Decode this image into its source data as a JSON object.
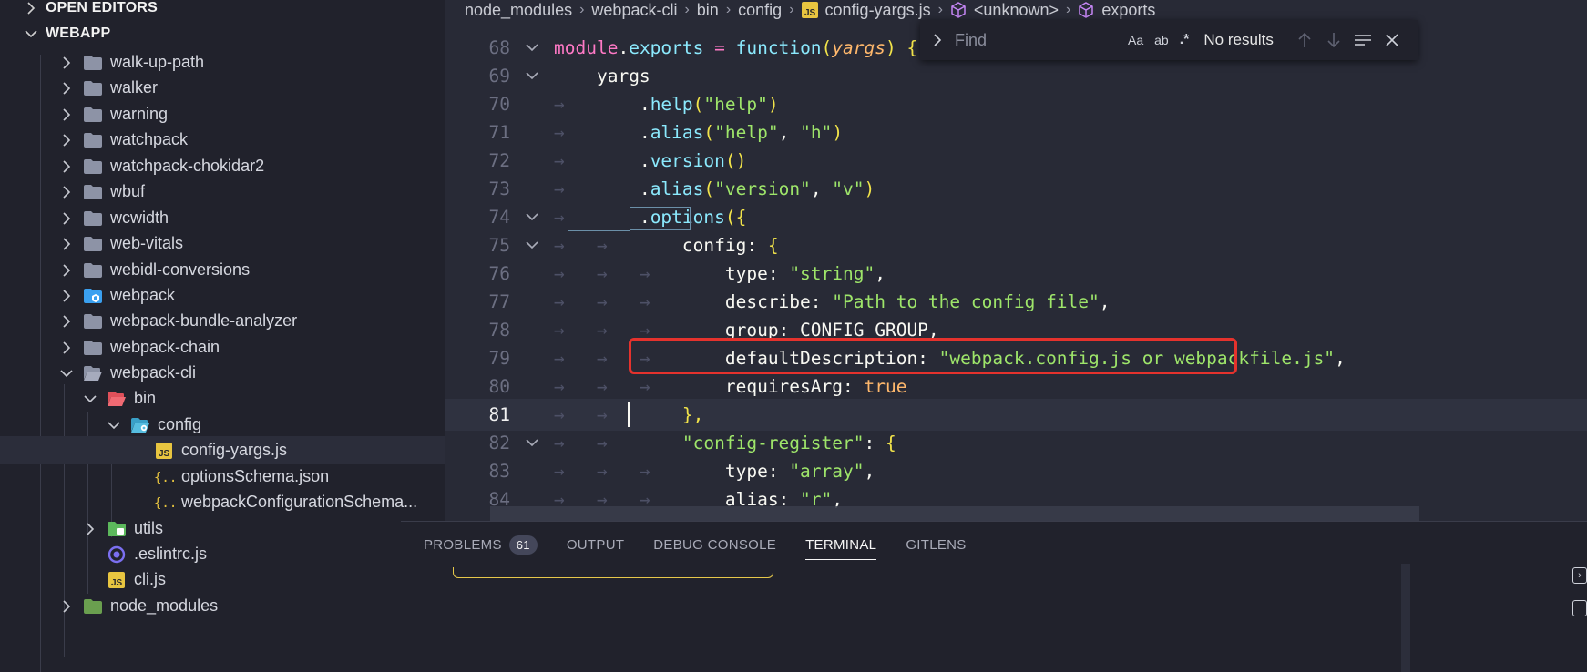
{
  "sidebar": {
    "open_editors_label": "OPEN EDITORS",
    "workspace_label": "WEBAPP",
    "items": [
      {
        "label": "walk-up-path",
        "kind": "folder",
        "icon": "folder-icon"
      },
      {
        "label": "walker",
        "kind": "folder",
        "icon": "folder-icon"
      },
      {
        "label": "warning",
        "kind": "folder",
        "icon": "folder-icon"
      },
      {
        "label": "watchpack",
        "kind": "folder",
        "icon": "folder-icon"
      },
      {
        "label": "watchpack-chokidar2",
        "kind": "folder",
        "icon": "folder-icon"
      },
      {
        "label": "wbuf",
        "kind": "folder",
        "icon": "folder-icon"
      },
      {
        "label": "wcwidth",
        "kind": "folder",
        "icon": "folder-icon"
      },
      {
        "label": "web-vitals",
        "kind": "folder",
        "icon": "folder-icon"
      },
      {
        "label": "webidl-conversions",
        "kind": "folder",
        "icon": "folder-icon"
      },
      {
        "label": "webpack",
        "kind": "folder",
        "icon": "webpack-folder-icon"
      },
      {
        "label": "webpack-bundle-analyzer",
        "kind": "folder",
        "icon": "folder-icon"
      },
      {
        "label": "webpack-chain",
        "kind": "folder",
        "icon": "folder-icon"
      },
      {
        "label": "webpack-cli",
        "kind": "folder-open",
        "icon": "folder-open-icon"
      },
      {
        "label": "bin",
        "kind": "folder-open",
        "icon": "bin-folder-icon"
      },
      {
        "label": "config",
        "kind": "folder-open",
        "icon": "config-folder-icon"
      },
      {
        "label": "config-yargs.js",
        "kind": "file",
        "icon": "js-file-icon"
      },
      {
        "label": "optionsSchema.json",
        "kind": "file",
        "icon": "json-file-icon"
      },
      {
        "label": "webpackConfigurationSchema...",
        "kind": "file",
        "icon": "json-file-icon"
      },
      {
        "label": "utils",
        "kind": "folder",
        "icon": "utils-folder-icon"
      },
      {
        "label": ".eslintrc.js",
        "kind": "file",
        "icon": "eslint-file-icon"
      },
      {
        "label": "cli.js",
        "kind": "file",
        "icon": "js-file-icon"
      },
      {
        "label": "node_modules",
        "kind": "folder",
        "icon": "node-modules-folder-icon"
      }
    ]
  },
  "breadcrumb": {
    "parts": [
      "node_modules",
      "webpack-cli",
      "bin",
      "config",
      "config-yargs.js",
      "<unknown>",
      "exports"
    ]
  },
  "find": {
    "placeholder": "Find",
    "match_case": "Aa",
    "whole_word": "ab",
    "regex": ".*",
    "result": "No results"
  },
  "editor": {
    "line_numbers": [
      "68",
      "69",
      "70",
      "71",
      "72",
      "73",
      "74",
      "75",
      "76",
      "77",
      "78",
      "79",
      "80",
      "81",
      "82",
      "83",
      "84"
    ],
    "current_line": "81",
    "lines": {
      "l68": {
        "a": "module",
        "b": ".",
        "c": "exports",
        "d": " = ",
        "e": "function",
        "f": "(",
        "g": "yargs",
        "h": ")",
        "i": " {"
      },
      "l69": {
        "a": "yargs"
      },
      "l70": {
        "a": ".",
        "b": "help",
        "c": "(",
        "d": "\"help\"",
        "e": ")"
      },
      "l71": {
        "a": ".",
        "b": "alias",
        "c": "(",
        "d": "\"help\"",
        "e": ", ",
        "f": "\"h\"",
        "g": ")"
      },
      "l72": {
        "a": ".",
        "b": "version",
        "c": "()"
      },
      "l73": {
        "a": ".",
        "b": "alias",
        "c": "(",
        "d": "\"version\"",
        "e": ", ",
        "f": "\"v\"",
        "g": ")"
      },
      "l74": {
        "a": ".",
        "b": "options",
        "c": "(",
        "d": "{"
      },
      "l75": {
        "a": "config: ",
        "b": "{"
      },
      "l76": {
        "a": "type: ",
        "b": "\"string\"",
        "c": ","
      },
      "l77": {
        "a": "describe: ",
        "b": "\"Path to the config file\"",
        "c": ","
      },
      "l78": {
        "a": "group: CONFIG_GROUP,"
      },
      "l79": {
        "a": "defaultDescription: ",
        "b": "\"webpack.config.js or webpackfile.js\"",
        "c": ","
      },
      "l80": {
        "a": "requiresArg: ",
        "b": "true"
      },
      "l81": {
        "a": "},"
      },
      "l82": {
        "a": "\"config-register\"",
        "b": ": ",
        "c": "{"
      },
      "l83": {
        "a": "type: ",
        "b": "\"array\"",
        "c": ","
      },
      "l84": {
        "a": "alias: ",
        "b": "\"r\"",
        "c": ","
      }
    }
  },
  "panel": {
    "tabs": [
      "PROBLEMS",
      "OUTPUT",
      "DEBUG CONSOLE",
      "TERMINAL",
      "GITLENS"
    ],
    "problems_count": "61",
    "active_tab": "TERMINAL"
  },
  "colors": {
    "highlight_border": "#e5322d",
    "accent_string": "#9ee56a",
    "keyword_pink": "#ff79c6"
  }
}
